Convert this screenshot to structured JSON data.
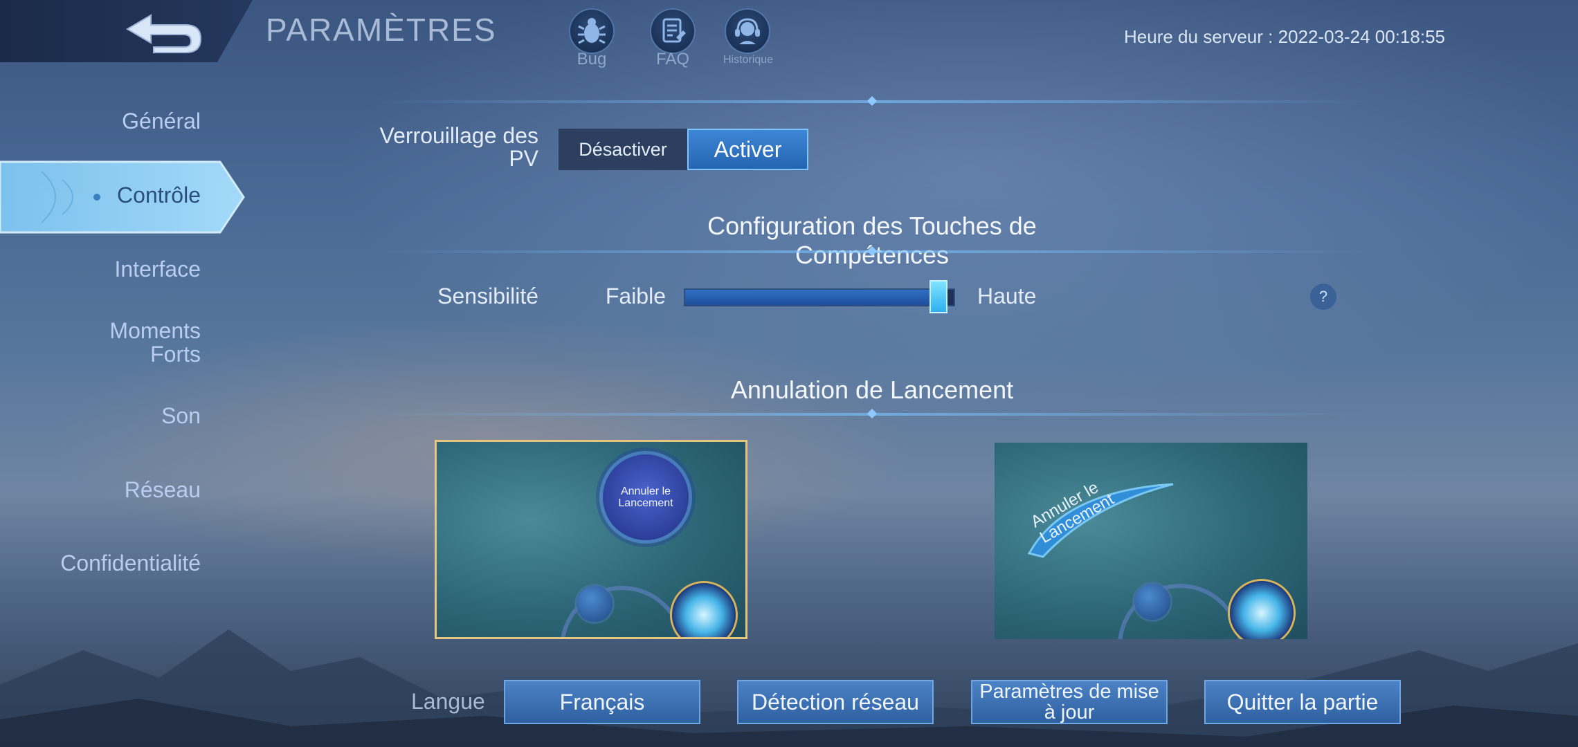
{
  "header": {
    "title": "PARAMÈTRES",
    "icons": [
      {
        "name": "bug",
        "label": "Bug"
      },
      {
        "name": "faq",
        "label": "FAQ"
      },
      {
        "name": "history",
        "label": "Historique"
      }
    ],
    "server_time": "Heure du serveur : 2022-03-24 00:18:55"
  },
  "sidebar": {
    "items": [
      {
        "label": "Général"
      },
      {
        "label": "Contrôle",
        "active": true
      },
      {
        "label": "Interface"
      },
      {
        "label": "Moments Forts"
      },
      {
        "label": "Son"
      },
      {
        "label": "Réseau"
      },
      {
        "label": "Confidentialité"
      }
    ]
  },
  "controls": {
    "hp_lock": {
      "label": "Verrouillage des PV",
      "off_label": "Désactiver",
      "on_label": "Activer",
      "selected": "Activer"
    },
    "skill_section_title": "Configuration des Touches de Compétences",
    "sensitivity": {
      "label": "Sensibilité",
      "low": "Faible",
      "high": "Haute",
      "value": 0.94
    },
    "cancel_section_title": "Annulation de Lancement",
    "cancel_options": [
      {
        "text": "Annuler le Lancement",
        "selected": true
      },
      {
        "text": "Annuler le Lancement",
        "selected": false
      }
    ]
  },
  "footer": {
    "language_label": "Langue",
    "language_value": "Français",
    "network_button": "Détection réseau",
    "update_button": "Paramètres de mise à jour",
    "quit_button": "Quitter la partie"
  },
  "colors": {
    "accent": "#3d86d6",
    "selected_border": "#e6c67f",
    "thumb": "#7fe4ff"
  }
}
